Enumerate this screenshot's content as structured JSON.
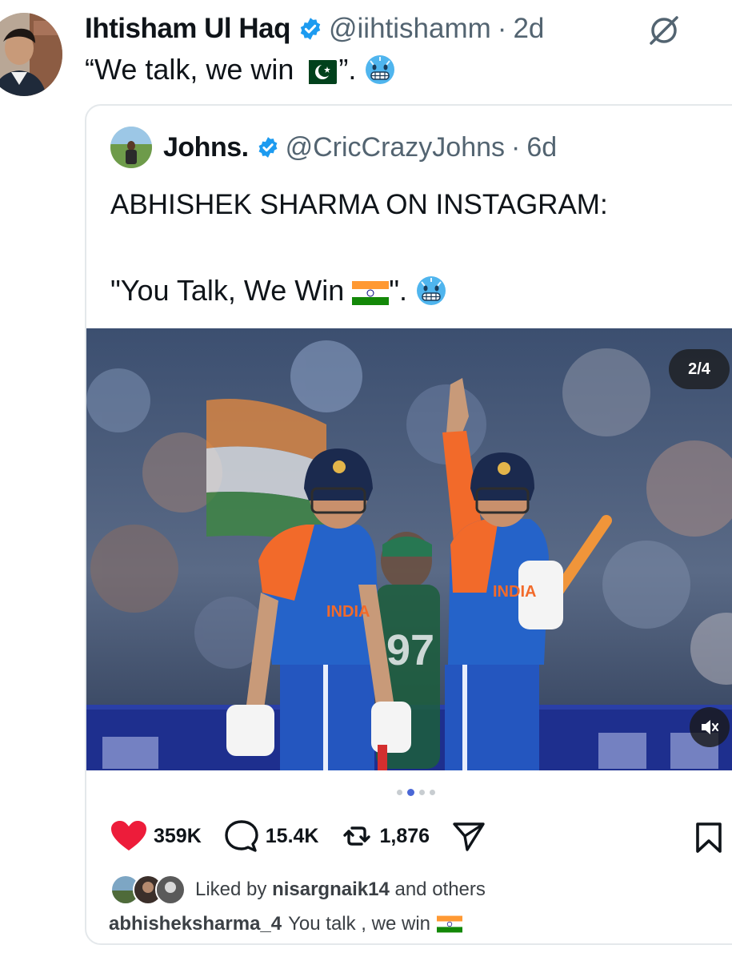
{
  "tweet": {
    "author_name": "Ihtisham Ul Haq",
    "handle": "@iihtishamm",
    "separator": "·",
    "time": "2d",
    "text": "“We talk, we win",
    "text_end": "”.",
    "flag": "pakistan-flag",
    "emoji": "cold-face"
  },
  "quote": {
    "author_name": "Johns.",
    "handle": "@CricCrazyJohns",
    "separator": "·",
    "time": "6d",
    "line1": "ABHISHEK SHARMA ON INSTAGRAM:",
    "line2": "\"You Talk, We Win",
    "line2_end": "\".",
    "media": {
      "counter": "2/4",
      "jersey_number": "97",
      "jersey_text": "INDIA",
      "dots_total": 4,
      "dots_active_index": 1
    },
    "actions": {
      "likes": "359K",
      "comments": "15.4K",
      "reposts": "1,876"
    },
    "liked_by_prefix": "Liked by",
    "liked_by_user": "nisargnaik14",
    "liked_by_suffix": "and others",
    "caption_user": "abhisheksharma_4",
    "caption_text": "You talk , we win"
  },
  "colors": {
    "verified": "#1d9bf0",
    "like": "#ed1c3a",
    "handle_gray": "#536471",
    "dot_active": "#4a67d6",
    "jersey_blue": "#2563c9",
    "jersey_orange": "#f26a2a"
  }
}
